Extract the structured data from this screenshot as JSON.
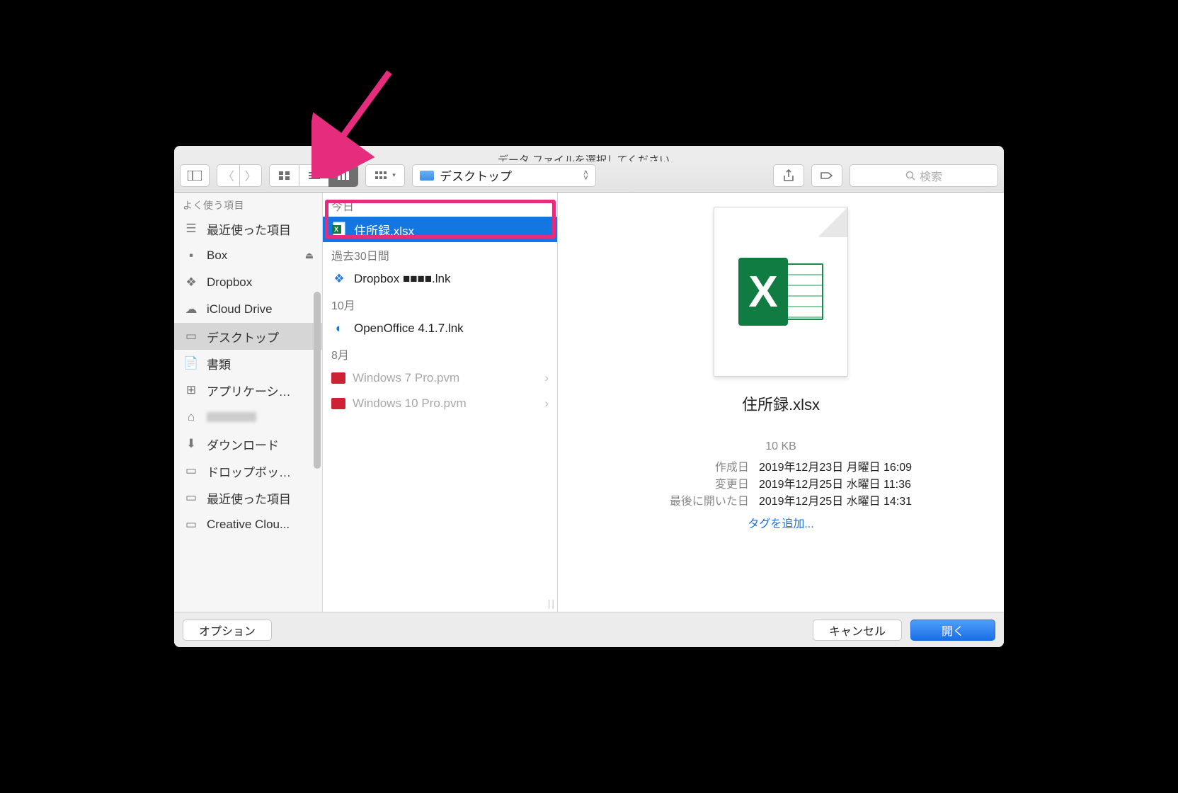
{
  "title": "データ ファイルを選択してください。",
  "toolbar": {
    "location": "デスクトップ",
    "search_placeholder": "検索"
  },
  "sidebar": {
    "header": "よく使う項目",
    "items": [
      {
        "label": "最近使った項目"
      },
      {
        "label": "Box"
      },
      {
        "label": "Dropbox"
      },
      {
        "label": "iCloud Drive"
      },
      {
        "label": "デスクトップ"
      },
      {
        "label": "書類"
      },
      {
        "label": "アプリケーシ…"
      },
      {
        "label": ""
      },
      {
        "label": "ダウンロード"
      },
      {
        "label": "ドロップボッ…"
      },
      {
        "label": "最近使った項目"
      },
      {
        "label": "Creative Clou..."
      }
    ]
  },
  "filelist": {
    "sections": [
      {
        "title": "今日",
        "items": [
          {
            "name": "住所録.xlsx"
          }
        ]
      },
      {
        "title": "過去30日間",
        "items": [
          {
            "name": "Dropbox ■■■■.lnk"
          }
        ]
      },
      {
        "title": "10月",
        "items": [
          {
            "name": "OpenOffice 4.1.7.lnk"
          }
        ]
      },
      {
        "title": "8月",
        "items": [
          {
            "name": "Windows 7 Pro.pvm"
          },
          {
            "name": "Windows 10 Pro.pvm"
          }
        ]
      }
    ]
  },
  "preview": {
    "filename": "住所録.xlsx",
    "size": "10 KB",
    "created_label": "作成日",
    "created_value": "2019年12月23日 月曜日 16:09",
    "modified_label": "変更日",
    "modified_value": "2019年12月25日 水曜日 11:36",
    "opened_label": "最後に開いた日",
    "opened_value": "2019年12月25日 水曜日 14:31",
    "tags": "タグを追加..."
  },
  "footer": {
    "options": "オプション",
    "cancel": "キャンセル",
    "open": "開く"
  }
}
